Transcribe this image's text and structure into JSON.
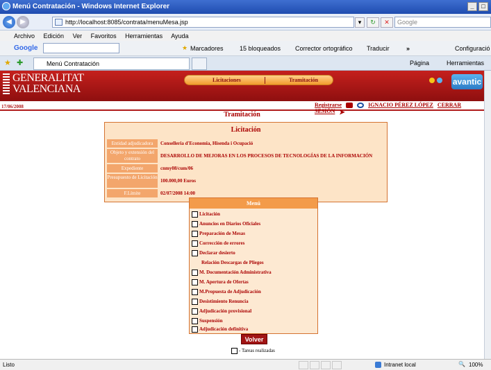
{
  "window": {
    "title": "Menú Contratación - Windows Internet Explorer"
  },
  "browser": {
    "url": "http://localhost:8085/contrata/menuMesa.jsp",
    "search_placeholder": "Google",
    "menu": [
      "Archivo",
      "Edición",
      "Ver",
      "Favoritos",
      "Herramientas",
      "Ayuda"
    ],
    "toolbar": {
      "google": "Google",
      "markers": "Marcadores",
      "blocked": "15 bloqueados",
      "spell": "Corrector ortográfico",
      "translate": "Traducir",
      "config": "Configuració"
    },
    "tab": "Menú Contratación",
    "cmdbar": {
      "page": "Página",
      "tools": "Herramientas"
    },
    "status": {
      "left": "Listo",
      "zone": "Intranet local",
      "zoom": "100%"
    }
  },
  "site": {
    "logo_line1": "GENERALITAT",
    "logo_line2": "VALENCIANA",
    "nav": [
      "Licitaciones",
      "Tramitación"
    ],
    "brand": "avantic",
    "date": "17/06/2008",
    "user_links": {
      "register": "Registrarse",
      "user": "IGNACIO PÉREZ LÓPEZ",
      "logout": "CERRAR SESIÓN"
    }
  },
  "page": {
    "title": "Tramitación",
    "licitacion": {
      "heading": "Licitación",
      "rows": [
        {
          "label": "Entidad adjudicadora",
          "value": "Conselleria d'Economia, Hisenda i Ocupació"
        },
        {
          "label": "Objeto y extensión del contrato",
          "value": "DESARROLLO DE MEJORAS EN LOS PROCESOS DE TECNOLOGÍAS DE LA INFORMACIÓN"
        },
        {
          "label": "Expediente",
          "value": "cnmy08/cum/06"
        },
        {
          "label": "Presupuesto de Licitación",
          "value": "100.000,00 Euros"
        },
        {
          "label": "F.Límite",
          "value": "02/07/2008 14:00"
        }
      ]
    },
    "menu": {
      "heading": "Menú",
      "items": [
        "Licitación",
        "Anuncios en Diarios Oficiales",
        "Preparación de Mesas",
        "Corrección de errores",
        "Declarar desierto",
        "Relación Descargas de Pliegos",
        "M. Documentación Administrativa",
        "M. Apertura de Ofertas",
        "M.Propuesta de Adjudicación",
        "Desistimiento Renuncia",
        "Adjudicación provisional",
        "Suspensión",
        "Adjudicación definitiva"
      ]
    },
    "volver": "Volver",
    "legend": "- Tareas realizadas"
  }
}
